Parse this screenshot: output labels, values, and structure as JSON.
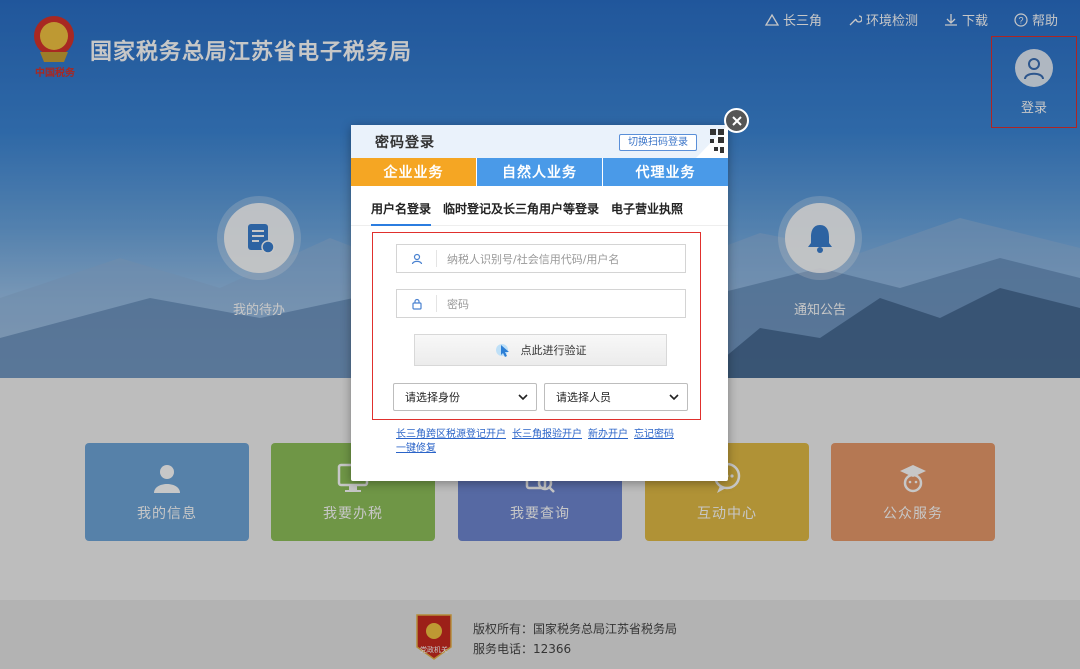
{
  "header": {
    "site_title": "国家税务总局江苏省电子税务局",
    "emblem_caption": "中国税务",
    "nav": [
      {
        "label": "长三角",
        "icon": "triangle-icon"
      },
      {
        "label": "环境检测",
        "icon": "wrench-icon"
      },
      {
        "label": "下载",
        "icon": "download-icon"
      },
      {
        "label": "帮助",
        "icon": "help-icon"
      }
    ],
    "login_label": "登录"
  },
  "quick_entries": [
    {
      "label": "我的待办",
      "icon": "todo-doc-icon"
    },
    {
      "label": "通知公告",
      "icon": "bell-icon"
    }
  ],
  "tiles": [
    {
      "label": "我的信息",
      "icon": "user-icon",
      "color": "#6fa6d9"
    },
    {
      "label": "我要办税",
      "icon": "monitor-icon",
      "color": "#8fc05a"
    },
    {
      "label": "我要查询",
      "icon": "search-doc-icon",
      "color": "#6f87d1"
    },
    {
      "label": "互动中心",
      "icon": "chat-icon",
      "color": "#e2bc46"
    },
    {
      "label": "公众服务",
      "icon": "service-icon",
      "color": "#e89a6b"
    }
  ],
  "footer": {
    "copyright": "版权所有：国家税务总局江苏省税务局",
    "phone": "服务电话：12366",
    "badge_text": "党政机关"
  },
  "modal": {
    "title": "密码登录",
    "qr_switch": "切换扫码登录",
    "business_tabs": [
      {
        "label": "企业业务",
        "active": true
      },
      {
        "label": "自然人业务",
        "active": false
      },
      {
        "label": "代理业务",
        "active": false
      }
    ],
    "sub_tabs": [
      {
        "label": "用户名登录",
        "active": true
      },
      {
        "label": "临时登记及长三角用户等登录",
        "active": false
      },
      {
        "label": "电子营业执照",
        "active": false
      }
    ],
    "username_placeholder": "纳税人识别号/社会信用代码/用户名",
    "password_placeholder": "密码",
    "verify_label": "点此进行验证",
    "identity_select": "请选择身份",
    "person_select": "请选择人员",
    "links": [
      "长三角跨区税源登记开户",
      "长三角报验开户",
      "新办开户",
      "忘记密码",
      "一键修复"
    ]
  },
  "colors": {
    "accent_orange": "#f5a623",
    "tab_blue": "#4a9ae8",
    "highlight_red": "#e0302d",
    "link_blue": "#2b64c8"
  }
}
